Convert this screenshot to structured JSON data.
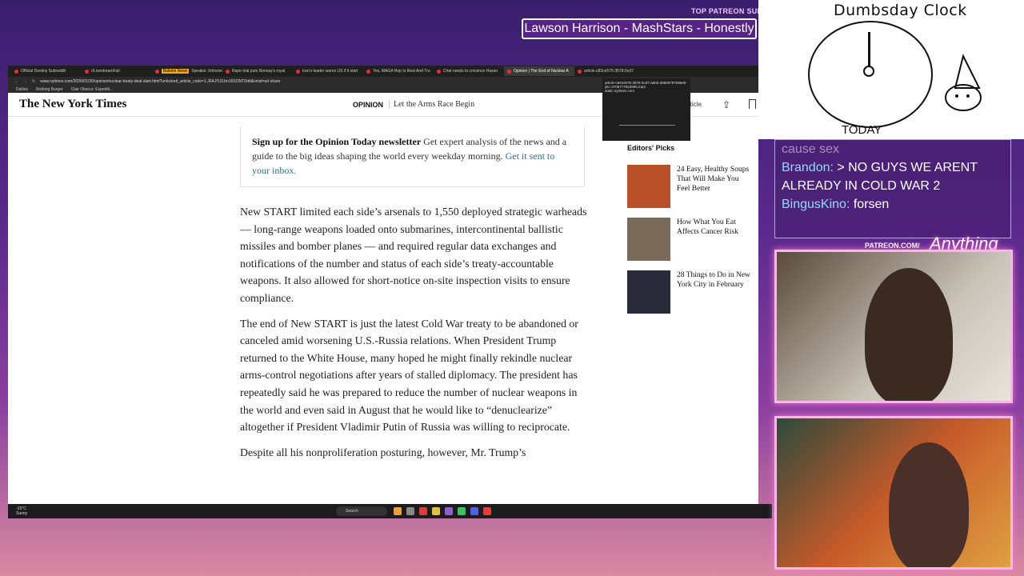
{
  "overlay": {
    "banner": "Lawson Harrison - MashStars - Honestly",
    "patreon_subs": "TOP PATREON SUBS",
    "patreon_tag": "PATREON.COM/",
    "anything_else": "Anything Else?"
  },
  "browser": {
    "tabs": [
      {
        "label": "Official Destiny Subreddit",
        "active": false
      },
      {
        "label": "r/LivestreamFail",
        "active": false
      },
      {
        "label": "Speaker Johnson is 'confident'",
        "active": false,
        "badge": "Bulletin News"
      },
      {
        "label": "Rape trial puts Norway's royal",
        "active": false
      },
      {
        "label": "Iran's leader warns US if it start",
        "active": false
      },
      {
        "label": "Yes, MAGA Rep Is Real And Tru",
        "active": false
      },
      {
        "label": "Chat needs to convince Hasan",
        "active": false
      },
      {
        "label": "Opinion | The End of Nuclear A",
        "active": true
      },
      {
        "label": "article-c83ce575-3578-5cd7",
        "active": false
      }
    ],
    "url": "www.nytimes.com/2026/01/30/opinion/nuclear-treaty-deal-start.html?unlocked_article_code=1.JFA.PU3.bn16SONT0rbt&smid=url-share",
    "bookmarks": [
      "Dailies",
      "Nothing Burger",
      "Clair Obscur: Expediti..."
    ],
    "tooltip": {
      "title": "article-c83ce575-3578-5cd7-a9eb-d9809797586eb-jstc-3709777843995.mp3",
      "host": "static.nytimes.com"
    }
  },
  "nyt": {
    "logo": "The New York Times",
    "section": "OPINION",
    "kicker": "Let the Arms Race Begin",
    "article_label": "rticle",
    "newsletter": {
      "title": "Sign up for the Opinion Today newsletter",
      "body": "Get expert analysis of the news and a guide to the big ideas shaping the world every weekday morning.",
      "link": "Get it sent to your inbox."
    },
    "paragraphs": [
      "New START limited each side’s arsenals to 1,550 deployed strategic warheads — long-range weapons loaded onto submarines, intercontinental ballistic missiles and bomber planes — and required regular data exchanges and notifications of the number and status of each side’s treaty-accountable weapons. It also allowed for short-notice on-site inspection visits to ensure compliance.",
      "The end of New START is just the latest Cold War treaty to be abandoned or canceled amid worsening U.S.-Russia relations. When President Trump returned to the White House, many hoped he might finally rekindle nuclear arms-control negotiations after years of stalled diplomacy. The president has repeatedly said he was prepared to reduce the number of nuclear weapons in the world and even said in August that he would like to “denuclearize” altogether if President Vladimir Putin of Russia was willing to reciprocate.",
      "Despite all his nonproliferation posturing, however, Mr. Trump’s"
    ],
    "editors_picks": {
      "title": "Editors' Picks",
      "items": [
        {
          "label": "24 Easy, Healthy Soups That Will Make You Feel Better",
          "color": "#b8502a"
        },
        {
          "label": "How What You Eat Affects Cancer Risk",
          "color": "#7a6a5a"
        },
        {
          "label": "28 Things to Do in New York City in February",
          "color": "#2a2a3a"
        }
      ]
    }
  },
  "taskbar": {
    "temp": "-15°C",
    "weather": "Sunny",
    "search": "Search"
  },
  "clock": {
    "title": "Dumbsday Clock",
    "today": "TODAY"
  },
  "chat": {
    "lines": [
      {
        "user": "",
        "text": "cause sex",
        "faded": true
      },
      {
        "user": "Brandon:",
        "text": "> NO GUYS WE ARENT ALREADY IN COLD WAR 2",
        "faded": false
      },
      {
        "user": "BingusKino:",
        "text": "forsen",
        "faded": false
      }
    ]
  }
}
